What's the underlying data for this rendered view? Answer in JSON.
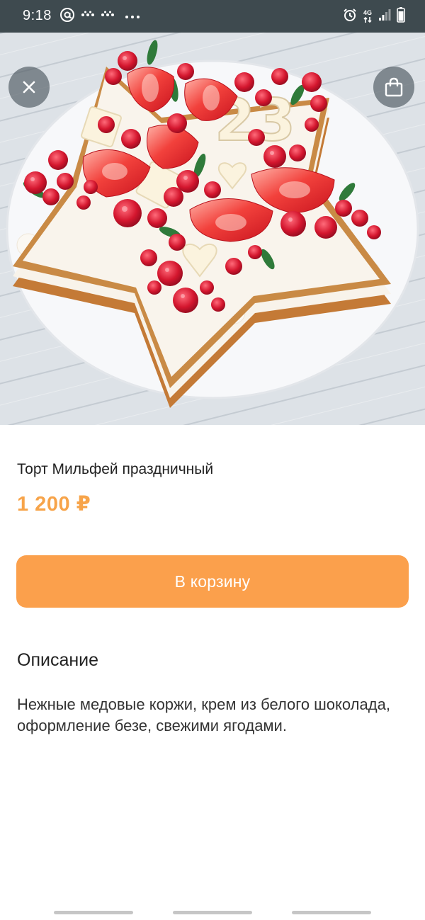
{
  "status_bar": {
    "time": "9:18",
    "network_label": "4G",
    "icons": [
      "at-sign-icon",
      "messenger-icon",
      "messenger-icon",
      "more-dots-icon",
      "alarm-icon",
      "network-4g-icon",
      "signal-icon",
      "battery-icon"
    ]
  },
  "hero": {
    "image_description_icon": "cake-photo",
    "close_icon": "close-icon",
    "cart_icon": "shopping-bag-icon",
    "cake_number": "23"
  },
  "product": {
    "title": "Торт Мильфей праздничный",
    "price": "1 200 ₽"
  },
  "actions": {
    "add_to_cart_label": "В корзину"
  },
  "description": {
    "heading": "Описание",
    "text": "Нежные медовые коржи, крем из белого шоколада, оформление безе, свежими ягодами."
  },
  "colors": {
    "accent": "#fba04c",
    "price": "#f7a44a",
    "status_bar": "#3e4a4f"
  }
}
